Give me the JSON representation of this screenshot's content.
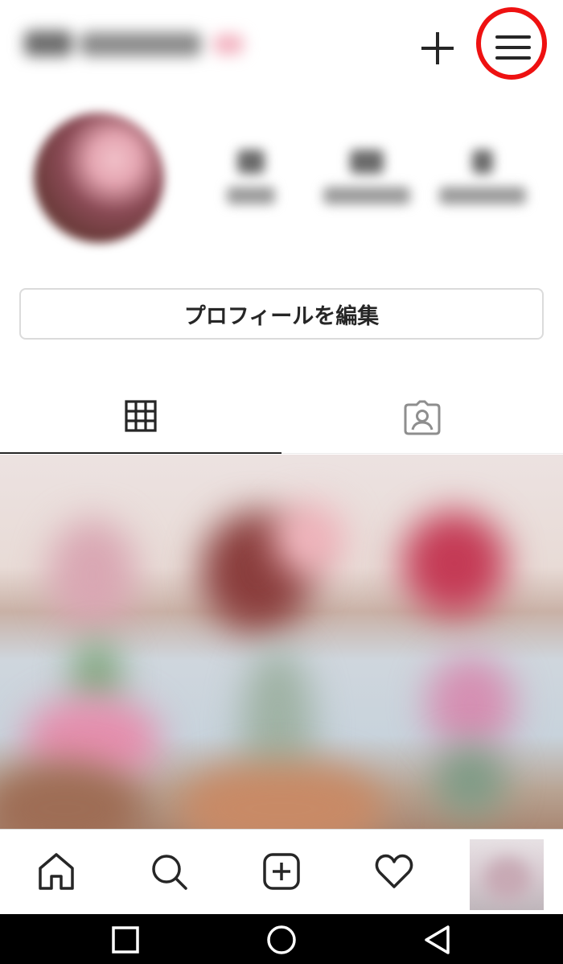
{
  "header": {
    "username": "",
    "icons": {
      "add": "plus-icon",
      "menu": "hamburger-menu-icon"
    },
    "highlight_color": "#ee1111"
  },
  "profile": {
    "edit_button_label": "プロフィールを編集"
  },
  "tabs": [
    {
      "icon": "grid-icon",
      "active": true
    },
    {
      "icon": "tagged-person-icon",
      "active": false
    }
  ],
  "bottom_nav": [
    {
      "icon": "home-icon"
    },
    {
      "icon": "search-icon"
    },
    {
      "icon": "add-post-icon"
    },
    {
      "icon": "heart-icon"
    },
    {
      "icon": "profile-thumbnail"
    }
  ],
  "system_nav": [
    {
      "icon": "recents-square-icon"
    },
    {
      "icon": "home-circle-icon"
    },
    {
      "icon": "back-triangle-icon"
    }
  ],
  "colors": {
    "text": "#262626",
    "border": "#dbdbdb",
    "annotation": "#ee1111"
  }
}
